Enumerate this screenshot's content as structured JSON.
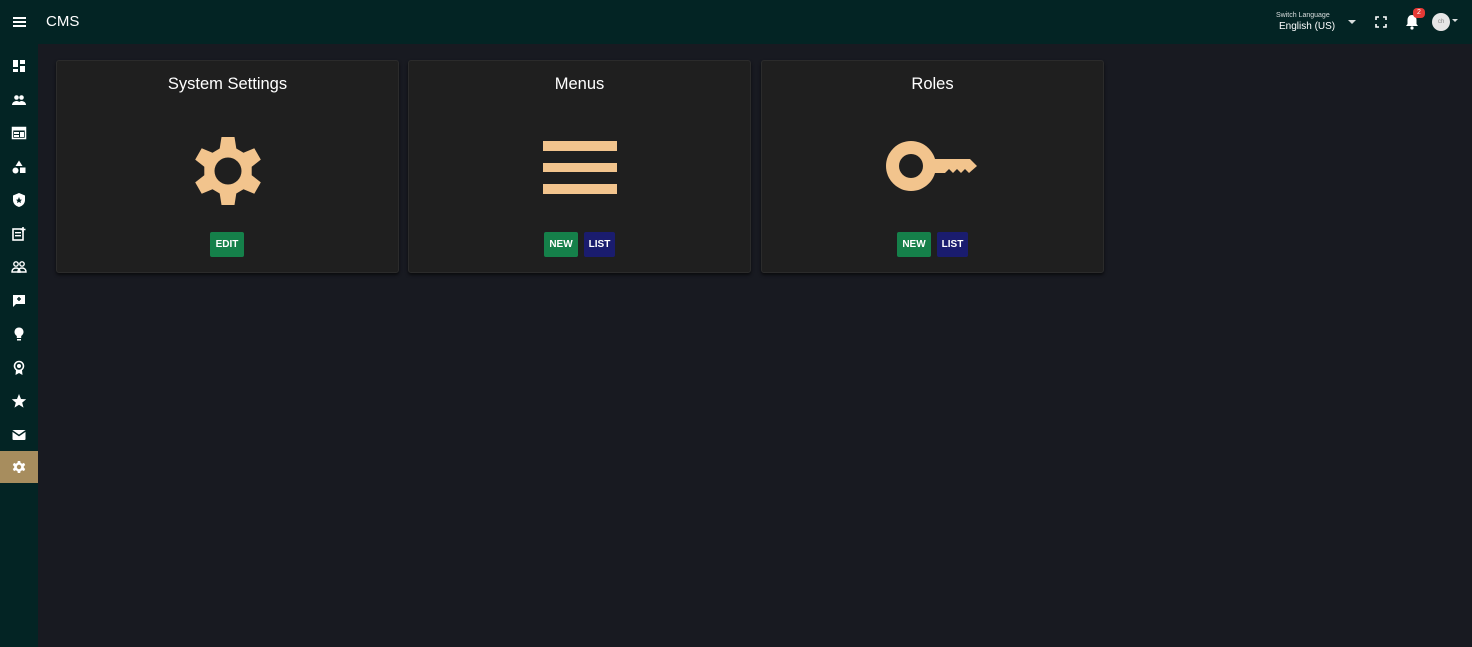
{
  "header": {
    "title": "CMS",
    "menu_icon": "hamburger-menu-icon",
    "language": {
      "label": "Switch Language",
      "value": "English (US)"
    },
    "notifications": {
      "count": "2"
    },
    "avatar_text": "ch"
  },
  "sidebar": {
    "items": [
      {
        "name": "dashboard",
        "icon": "dashboard-icon"
      },
      {
        "name": "users",
        "icon": "people-icon"
      },
      {
        "name": "web",
        "icon": "web-layout-icon"
      },
      {
        "name": "categories",
        "icon": "shapes-icon"
      },
      {
        "name": "security",
        "icon": "shield-icon"
      },
      {
        "name": "posts",
        "icon": "post-add-icon"
      },
      {
        "name": "groups",
        "icon": "group-icon"
      },
      {
        "name": "feedback",
        "icon": "feedback-icon"
      },
      {
        "name": "tips",
        "icon": "lightbulb-icon"
      },
      {
        "name": "awards",
        "icon": "award-icon"
      },
      {
        "name": "favorites",
        "icon": "star-icon"
      },
      {
        "name": "mail",
        "icon": "mail-icon"
      },
      {
        "name": "settings",
        "icon": "gear-icon",
        "active": true
      }
    ]
  },
  "cards": [
    {
      "title": "System Settings",
      "icon": "gear-icon",
      "buttons": [
        "EDIT"
      ]
    },
    {
      "title": "Menus",
      "icon": "menu-lines-icon",
      "buttons": [
        "NEW",
        "LIST"
      ]
    },
    {
      "title": "Roles",
      "icon": "key-icon",
      "buttons": [
        "NEW",
        "LIST"
      ]
    }
  ],
  "colors": {
    "topbar": "#032424",
    "background": "#181a21",
    "card": "#1f1f1f",
    "icon_accent": "#f2c48d",
    "btn_green": "#15804a",
    "btn_blue": "#1a1c6e",
    "active_sidebar": "#a78d5e"
  }
}
